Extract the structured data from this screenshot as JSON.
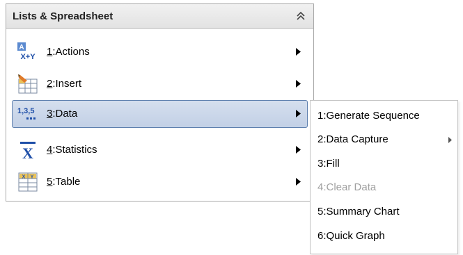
{
  "panel": {
    "title": "Lists & Spreadsheet",
    "collapse_icon": "double-chevron-up-icon",
    "items": [
      {
        "num": "1",
        "label": ":Actions",
        "icon": "actions-icon",
        "icon_text_top": "A",
        "icon_text_bottom": "X+Y",
        "has_submenu": true
      },
      {
        "num": "2",
        "label": ":Insert",
        "icon": "insert-icon",
        "has_submenu": true
      },
      {
        "num": "3",
        "label": ":Data",
        "icon": "data-icon",
        "icon_text": "1,3,5",
        "has_submenu": true,
        "selected": true
      },
      {
        "num": "4",
        "label": ":Statistics",
        "icon": "statistics-icon",
        "icon_text": "X",
        "has_submenu": true
      },
      {
        "num": "5",
        "label": ":Table",
        "icon": "table-icon",
        "icon_text_left": "X",
        "icon_text_right": "Y",
        "has_submenu": true
      }
    ]
  },
  "submenu": {
    "items": [
      {
        "label": "1:Generate Sequence",
        "enabled": true
      },
      {
        "label": "2:Data Capture",
        "enabled": true,
        "has_submenu": true
      },
      {
        "label": "3:Fill",
        "enabled": true
      },
      {
        "label": "4:Clear Data",
        "enabled": false
      },
      {
        "label": "5:Summary Chart",
        "enabled": true
      },
      {
        "label": "6:Quick Graph",
        "enabled": true
      }
    ]
  },
  "colors": {
    "selection_border": "#5d7fae",
    "selection_fill": "#c9d6ea",
    "icon_blue": "#1f4fa8",
    "disabled_text": "#a0a0a0"
  }
}
